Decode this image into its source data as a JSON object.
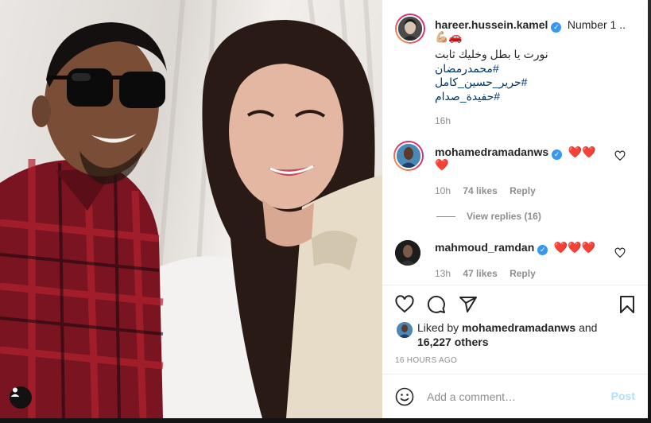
{
  "post": {
    "author": "hareer.hussein.kamel",
    "caption_suffix": "Number 1 ..",
    "caption_emoji": "💪🏼🚗",
    "caption_line": "نورت يا بطل وخليك ثابت",
    "hashtags": [
      "#محمدرمضان",
      "#حرير_حسين_كامل",
      "#حفيدة_صدام"
    ],
    "time": "16h"
  },
  "comments": [
    {
      "username": "mohamedramadanws",
      "text": "❤️❤️",
      "text2": "❤️",
      "time": "10h",
      "likes": "74 likes",
      "reply": "Reply",
      "view_replies": "View replies (16)"
    },
    {
      "username": "mahmoud_ramdan",
      "text": "❤️❤️❤️",
      "time": "13h",
      "likes": "47 likes",
      "reply": "Reply"
    }
  ],
  "likes_summary": {
    "prefix": "Liked by",
    "user": "mohamedramadanws",
    "and": "and",
    "others": "16,227 others"
  },
  "posted_ago": "16 HOURS AGO",
  "comment_input": {
    "placeholder": "Add a comment…",
    "post_label": "Post"
  },
  "colors": {
    "link": "#00376b",
    "verified": "#3897f0",
    "post_disabled": "#b2dffc"
  }
}
